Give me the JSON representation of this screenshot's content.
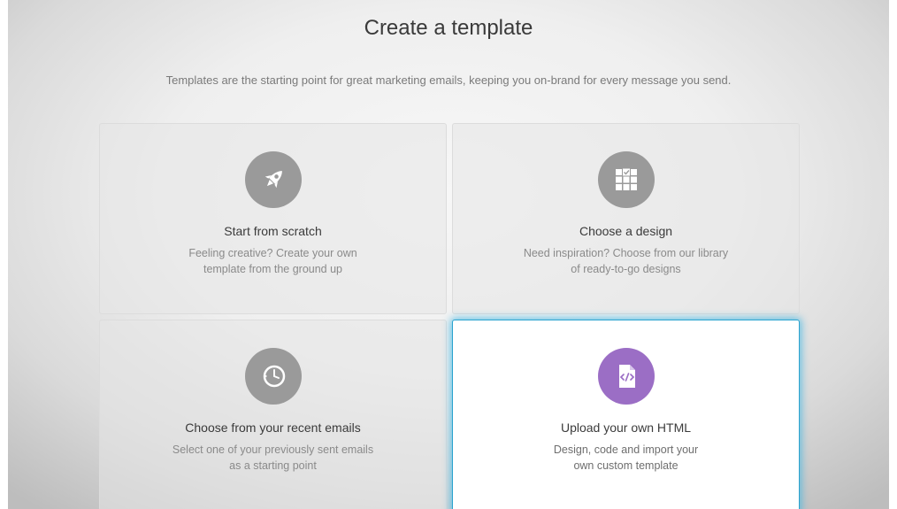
{
  "header": {
    "title": "Create a template",
    "subtitle": "Templates are the starting point for great marketing emails, keeping you on-brand for every message you send."
  },
  "options": [
    {
      "title": "Start from scratch",
      "desc_line1": "Feeling creative? Create your own",
      "desc_line2": "template from the ground up",
      "icon": "rocket-icon"
    },
    {
      "title": "Choose a design",
      "desc_line1": "Need inspiration? Choose from our library",
      "desc_line2": "of ready-to-go designs",
      "icon": "layout-grid-icon"
    },
    {
      "title": "Choose from your recent emails",
      "desc_line1": "Select one of your previously sent emails",
      "desc_line2": "as a starting point",
      "icon": "history-clock-icon"
    },
    {
      "title": "Upload your own HTML",
      "desc_line1": "Design, code and import your",
      "desc_line2": "own custom template",
      "icon": "html-file-icon"
    }
  ],
  "colors": {
    "accent_glow": "#2aa3cf",
    "html_icon_bg": "#9b6ec5",
    "icon_bg": "#9a9a9a"
  }
}
